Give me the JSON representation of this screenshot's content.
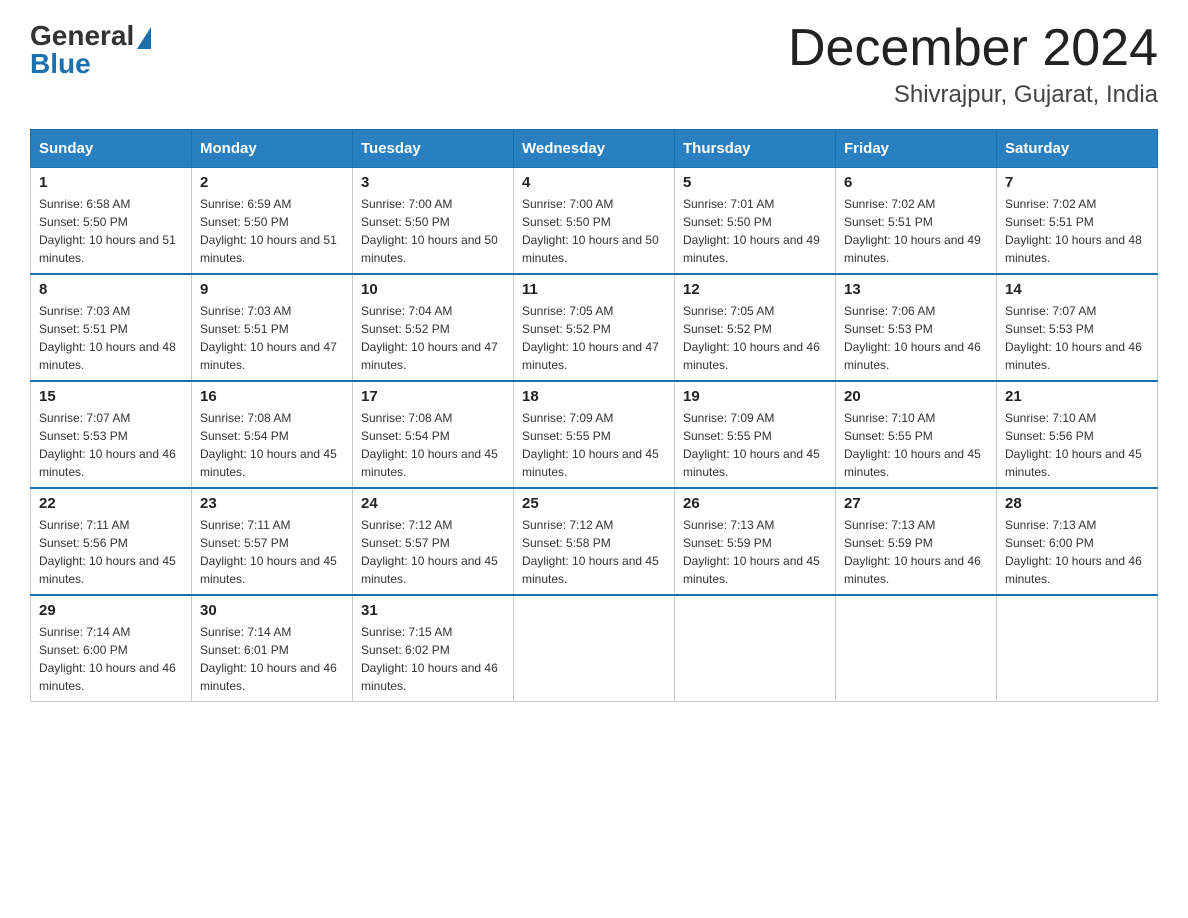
{
  "header": {
    "logo_general": "General",
    "logo_blue": "Blue",
    "month_title": "December 2024",
    "subtitle": "Shivrajpur, Gujarat, India"
  },
  "weekdays": [
    "Sunday",
    "Monday",
    "Tuesday",
    "Wednesday",
    "Thursday",
    "Friday",
    "Saturday"
  ],
  "weeks": [
    [
      {
        "day": "1",
        "sunrise": "6:58 AM",
        "sunset": "5:50 PM",
        "daylight": "10 hours and 51 minutes."
      },
      {
        "day": "2",
        "sunrise": "6:59 AM",
        "sunset": "5:50 PM",
        "daylight": "10 hours and 51 minutes."
      },
      {
        "day": "3",
        "sunrise": "7:00 AM",
        "sunset": "5:50 PM",
        "daylight": "10 hours and 50 minutes."
      },
      {
        "day": "4",
        "sunrise": "7:00 AM",
        "sunset": "5:50 PM",
        "daylight": "10 hours and 50 minutes."
      },
      {
        "day": "5",
        "sunrise": "7:01 AM",
        "sunset": "5:50 PM",
        "daylight": "10 hours and 49 minutes."
      },
      {
        "day": "6",
        "sunrise": "7:02 AM",
        "sunset": "5:51 PM",
        "daylight": "10 hours and 49 minutes."
      },
      {
        "day": "7",
        "sunrise": "7:02 AM",
        "sunset": "5:51 PM",
        "daylight": "10 hours and 48 minutes."
      }
    ],
    [
      {
        "day": "8",
        "sunrise": "7:03 AM",
        "sunset": "5:51 PM",
        "daylight": "10 hours and 48 minutes."
      },
      {
        "day": "9",
        "sunrise": "7:03 AM",
        "sunset": "5:51 PM",
        "daylight": "10 hours and 47 minutes."
      },
      {
        "day": "10",
        "sunrise": "7:04 AM",
        "sunset": "5:52 PM",
        "daylight": "10 hours and 47 minutes."
      },
      {
        "day": "11",
        "sunrise": "7:05 AM",
        "sunset": "5:52 PM",
        "daylight": "10 hours and 47 minutes."
      },
      {
        "day": "12",
        "sunrise": "7:05 AM",
        "sunset": "5:52 PM",
        "daylight": "10 hours and 46 minutes."
      },
      {
        "day": "13",
        "sunrise": "7:06 AM",
        "sunset": "5:53 PM",
        "daylight": "10 hours and 46 minutes."
      },
      {
        "day": "14",
        "sunrise": "7:07 AM",
        "sunset": "5:53 PM",
        "daylight": "10 hours and 46 minutes."
      }
    ],
    [
      {
        "day": "15",
        "sunrise": "7:07 AM",
        "sunset": "5:53 PM",
        "daylight": "10 hours and 46 minutes."
      },
      {
        "day": "16",
        "sunrise": "7:08 AM",
        "sunset": "5:54 PM",
        "daylight": "10 hours and 45 minutes."
      },
      {
        "day": "17",
        "sunrise": "7:08 AM",
        "sunset": "5:54 PM",
        "daylight": "10 hours and 45 minutes."
      },
      {
        "day": "18",
        "sunrise": "7:09 AM",
        "sunset": "5:55 PM",
        "daylight": "10 hours and 45 minutes."
      },
      {
        "day": "19",
        "sunrise": "7:09 AM",
        "sunset": "5:55 PM",
        "daylight": "10 hours and 45 minutes."
      },
      {
        "day": "20",
        "sunrise": "7:10 AM",
        "sunset": "5:55 PM",
        "daylight": "10 hours and 45 minutes."
      },
      {
        "day": "21",
        "sunrise": "7:10 AM",
        "sunset": "5:56 PM",
        "daylight": "10 hours and 45 minutes."
      }
    ],
    [
      {
        "day": "22",
        "sunrise": "7:11 AM",
        "sunset": "5:56 PM",
        "daylight": "10 hours and 45 minutes."
      },
      {
        "day": "23",
        "sunrise": "7:11 AM",
        "sunset": "5:57 PM",
        "daylight": "10 hours and 45 minutes."
      },
      {
        "day": "24",
        "sunrise": "7:12 AM",
        "sunset": "5:57 PM",
        "daylight": "10 hours and 45 minutes."
      },
      {
        "day": "25",
        "sunrise": "7:12 AM",
        "sunset": "5:58 PM",
        "daylight": "10 hours and 45 minutes."
      },
      {
        "day": "26",
        "sunrise": "7:13 AM",
        "sunset": "5:59 PM",
        "daylight": "10 hours and 45 minutes."
      },
      {
        "day": "27",
        "sunrise": "7:13 AM",
        "sunset": "5:59 PM",
        "daylight": "10 hours and 46 minutes."
      },
      {
        "day": "28",
        "sunrise": "7:13 AM",
        "sunset": "6:00 PM",
        "daylight": "10 hours and 46 minutes."
      }
    ],
    [
      {
        "day": "29",
        "sunrise": "7:14 AM",
        "sunset": "6:00 PM",
        "daylight": "10 hours and 46 minutes."
      },
      {
        "day": "30",
        "sunrise": "7:14 AM",
        "sunset": "6:01 PM",
        "daylight": "10 hours and 46 minutes."
      },
      {
        "day": "31",
        "sunrise": "7:15 AM",
        "sunset": "6:02 PM",
        "daylight": "10 hours and 46 minutes."
      },
      null,
      null,
      null,
      null
    ]
  ]
}
